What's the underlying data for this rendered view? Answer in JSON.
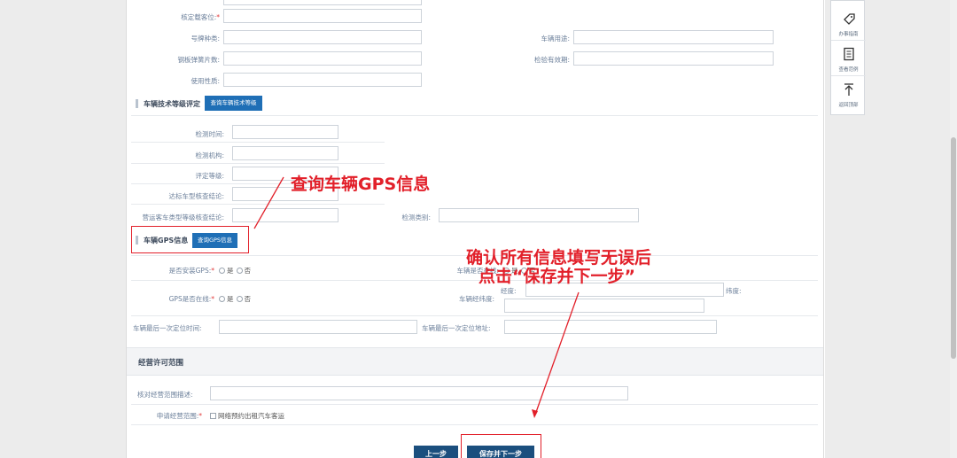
{
  "form": {
    "fields_top": {
      "approved_seats": {
        "label": "核定载客位:",
        "required_mark": "*"
      },
      "plate_type": {
        "label": "号牌种类:"
      },
      "vehicle_use": {
        "label": "车辆用途:"
      },
      "leaf_springs": {
        "label": "钢板弹簧片数:"
      },
      "inspection_valid": {
        "label": "检验有效期:"
      },
      "use_nature": {
        "label": "使用性质:"
      }
    },
    "tech_grade": {
      "title": "车辆技术等级评定",
      "query_button": "查询车辆技术等级",
      "inspection_time": "检测时间:",
      "inspection_org": "检测机构:",
      "grade": "评定等级:",
      "model_check": "达标车型核查结论:",
      "passenger_grade_check": "营运客车类型等级核查结论:",
      "inspection_type": "检测类别:"
    },
    "gps": {
      "title": "车辆GPS信息",
      "query_button": "查询GPS信息",
      "installed_label": "是否安装GPS:",
      "online_label": "GPS是否在线:",
      "required_mark": "*",
      "yes": "是",
      "no": "否",
      "vehicle_online_label": "车辆是否在线:",
      "lnglat_label": "车辆经纬度:",
      "longitude": "经度:",
      "latitude": "纬度:",
      "last_time_label": "车辆最后一次定位时间:",
      "last_addr_label": "车辆最后一次定位地址:"
    },
    "scope": {
      "title": "经营许可范围",
      "desc_label": "核对经营范围描述:",
      "apply_label": "申请经营范围:",
      "required_mark": "*",
      "option": "网络预约出租汽车客运"
    },
    "buttons": {
      "prev": "上一步",
      "save_next": "保存并下一步"
    }
  },
  "annotations": {
    "gps_note": "查询车辆GPS信息",
    "save_note_line1": "确认所有信息填写无误后",
    "save_note_line2": "点击“保存并下一步”"
  },
  "sidebar": {
    "guide": "办事指南",
    "sample": "查看范例",
    "top": "返回顶部"
  },
  "colors": {
    "annotation_red": "#e2202a",
    "primary_button": "#1f6fb6",
    "save_button": "#1b4f7e"
  }
}
